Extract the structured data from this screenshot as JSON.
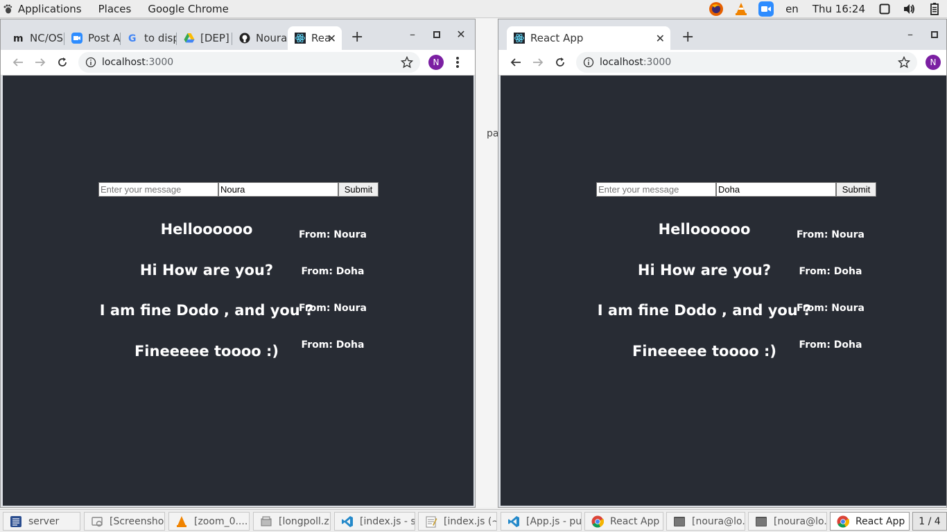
{
  "top_panel": {
    "menus": [
      "Applications",
      "Places",
      "Google Chrome"
    ],
    "lang": "en",
    "clock": "Thu 16:24"
  },
  "desktop": {
    "peek_text": "pa"
  },
  "left_window": {
    "tabs": [
      "NC/OS",
      "Post A",
      "to disp",
      "[DEP]",
      "Noura",
      "Rea"
    ],
    "url_host": "localhost",
    "url_port": ":3000",
    "profile_initial": "N",
    "form": {
      "placeholder": "Enter your message",
      "name_value": "Noura",
      "submit_label": "Submit"
    },
    "messages": [
      {
        "text": "Helloooooo",
        "from": "From: Noura"
      },
      {
        "text": "Hi How are you?",
        "from": "From: Doha"
      },
      {
        "text": "I am fine Dodo , and you ?",
        "from": "From: Noura"
      },
      {
        "text": "Fineeeee toooo :)",
        "from": "From: Doha"
      }
    ]
  },
  "right_window": {
    "tab_title": "React App",
    "url_host": "localhost",
    "url_port": ":3000",
    "profile_initial": "N",
    "form": {
      "placeholder": "Enter your message",
      "name_value": "Doha",
      "submit_label": "Submit"
    },
    "messages": [
      {
        "text": "Helloooooo",
        "from": "From: Noura"
      },
      {
        "text": "Hi How are you?",
        "from": "From: Doha"
      },
      {
        "text": "I am fine Dodo , and you ?",
        "from": "From: Noura"
      },
      {
        "text": "Fineeeee toooo :)",
        "from": "From: Doha"
      }
    ]
  },
  "taskbar": {
    "items": [
      "server",
      "[Screensho...",
      "[zoom_0....",
      "[longpoll.zi...",
      "[index.js - s...",
      "[index.js (~...",
      "[App.js - pu...",
      "React App ...",
      "[noura@lo...",
      "[noura@lo...",
      "React App ..."
    ],
    "pager": "1 / 4"
  },
  "colors": {
    "app_bg": "#282c34",
    "chrome_frame": "#dee1e6",
    "profile": "#7b1fa2"
  }
}
